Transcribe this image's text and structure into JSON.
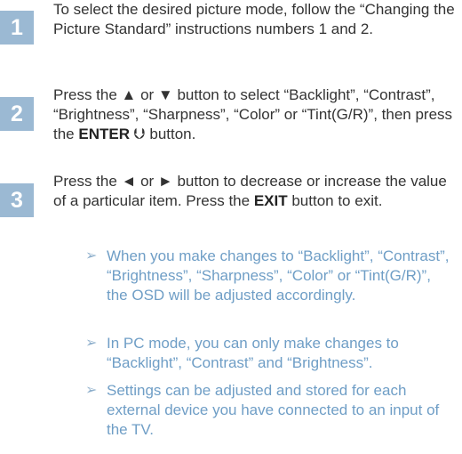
{
  "steps": [
    {
      "number": "1",
      "text": "To select the desired picture mode, follow the “Changing the Picture Standard” instructions numbers 1 and 2."
    },
    {
      "number": "2",
      "text_before": "Press the ▲ or ▼ button to select “Backlight”, “Contrast”, “Brightness”, “Sharpness”, “Color” or “Tint(G/R)”, then press the ",
      "bold": "ENTER",
      "enter_icon": "⮋",
      "text_after": " button."
    },
    {
      "number": "3",
      "text_before": "Press the ◄ or ► button to decrease or increase the value of a particular item. Press the ",
      "bold": "EXIT",
      "text_after": " button to exit."
    }
  ],
  "notes": [
    {
      "arrow": "➢",
      "text": "When you make changes to “Backlight”, “Contrast”, “Brightness”, “Sharpness”, “Color” or “Tint(G/R)”, the OSD will be adjusted accordingly."
    },
    {
      "arrow": "➢",
      "text": "In PC mode, you can only make changes to “Backlight”, “Contrast” and “Brightness”."
    },
    {
      "arrow": "➢",
      "text": "Settings can be adjusted and stored for each external device you have connected to an input of the TV."
    }
  ],
  "colors": {
    "step_badge": "#9bb9d3",
    "note_text": "#6f9ec6",
    "body_text": "#333333"
  }
}
